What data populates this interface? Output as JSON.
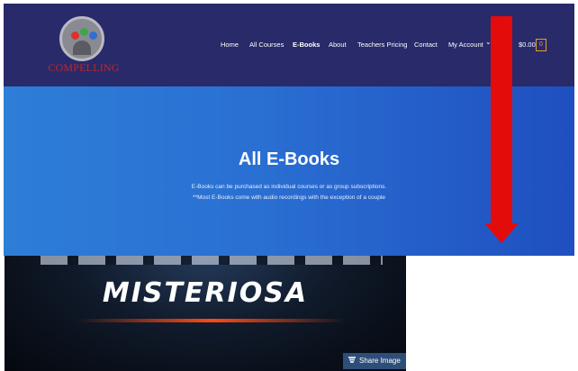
{
  "header": {
    "logo_text": "COMPELLING",
    "nav": [
      {
        "label": "Home"
      },
      {
        "label": "All Courses"
      },
      {
        "label": "E-Books"
      },
      {
        "label": "About"
      },
      {
        "label": "Teachers Pricing"
      },
      {
        "label": "Contact"
      },
      {
        "label": "My Account"
      }
    ],
    "account_chevron": "⌄",
    "cart_amount": "$0.00",
    "cart_count": "0"
  },
  "hero": {
    "title": "All E-Books",
    "line1": "E-Books can be purchased as individual courses or as group subscriptions.",
    "line2": "**Most E-Books come with audio recordings with the exception of a couple"
  },
  "book": {
    "title": "MISTERIOSA",
    "share_label": "Share Image"
  },
  "colors": {
    "header_bg": "#282a6a",
    "hero_start": "#2d7ed7",
    "hero_end": "#1f4fc0",
    "arrow": "#e40b0b",
    "logo_text": "#c2262b"
  },
  "icons": {
    "logo": "logo-circle-icon",
    "cart": "cart-icon",
    "share": "share-icon",
    "arrow": "down-arrow-icon"
  }
}
